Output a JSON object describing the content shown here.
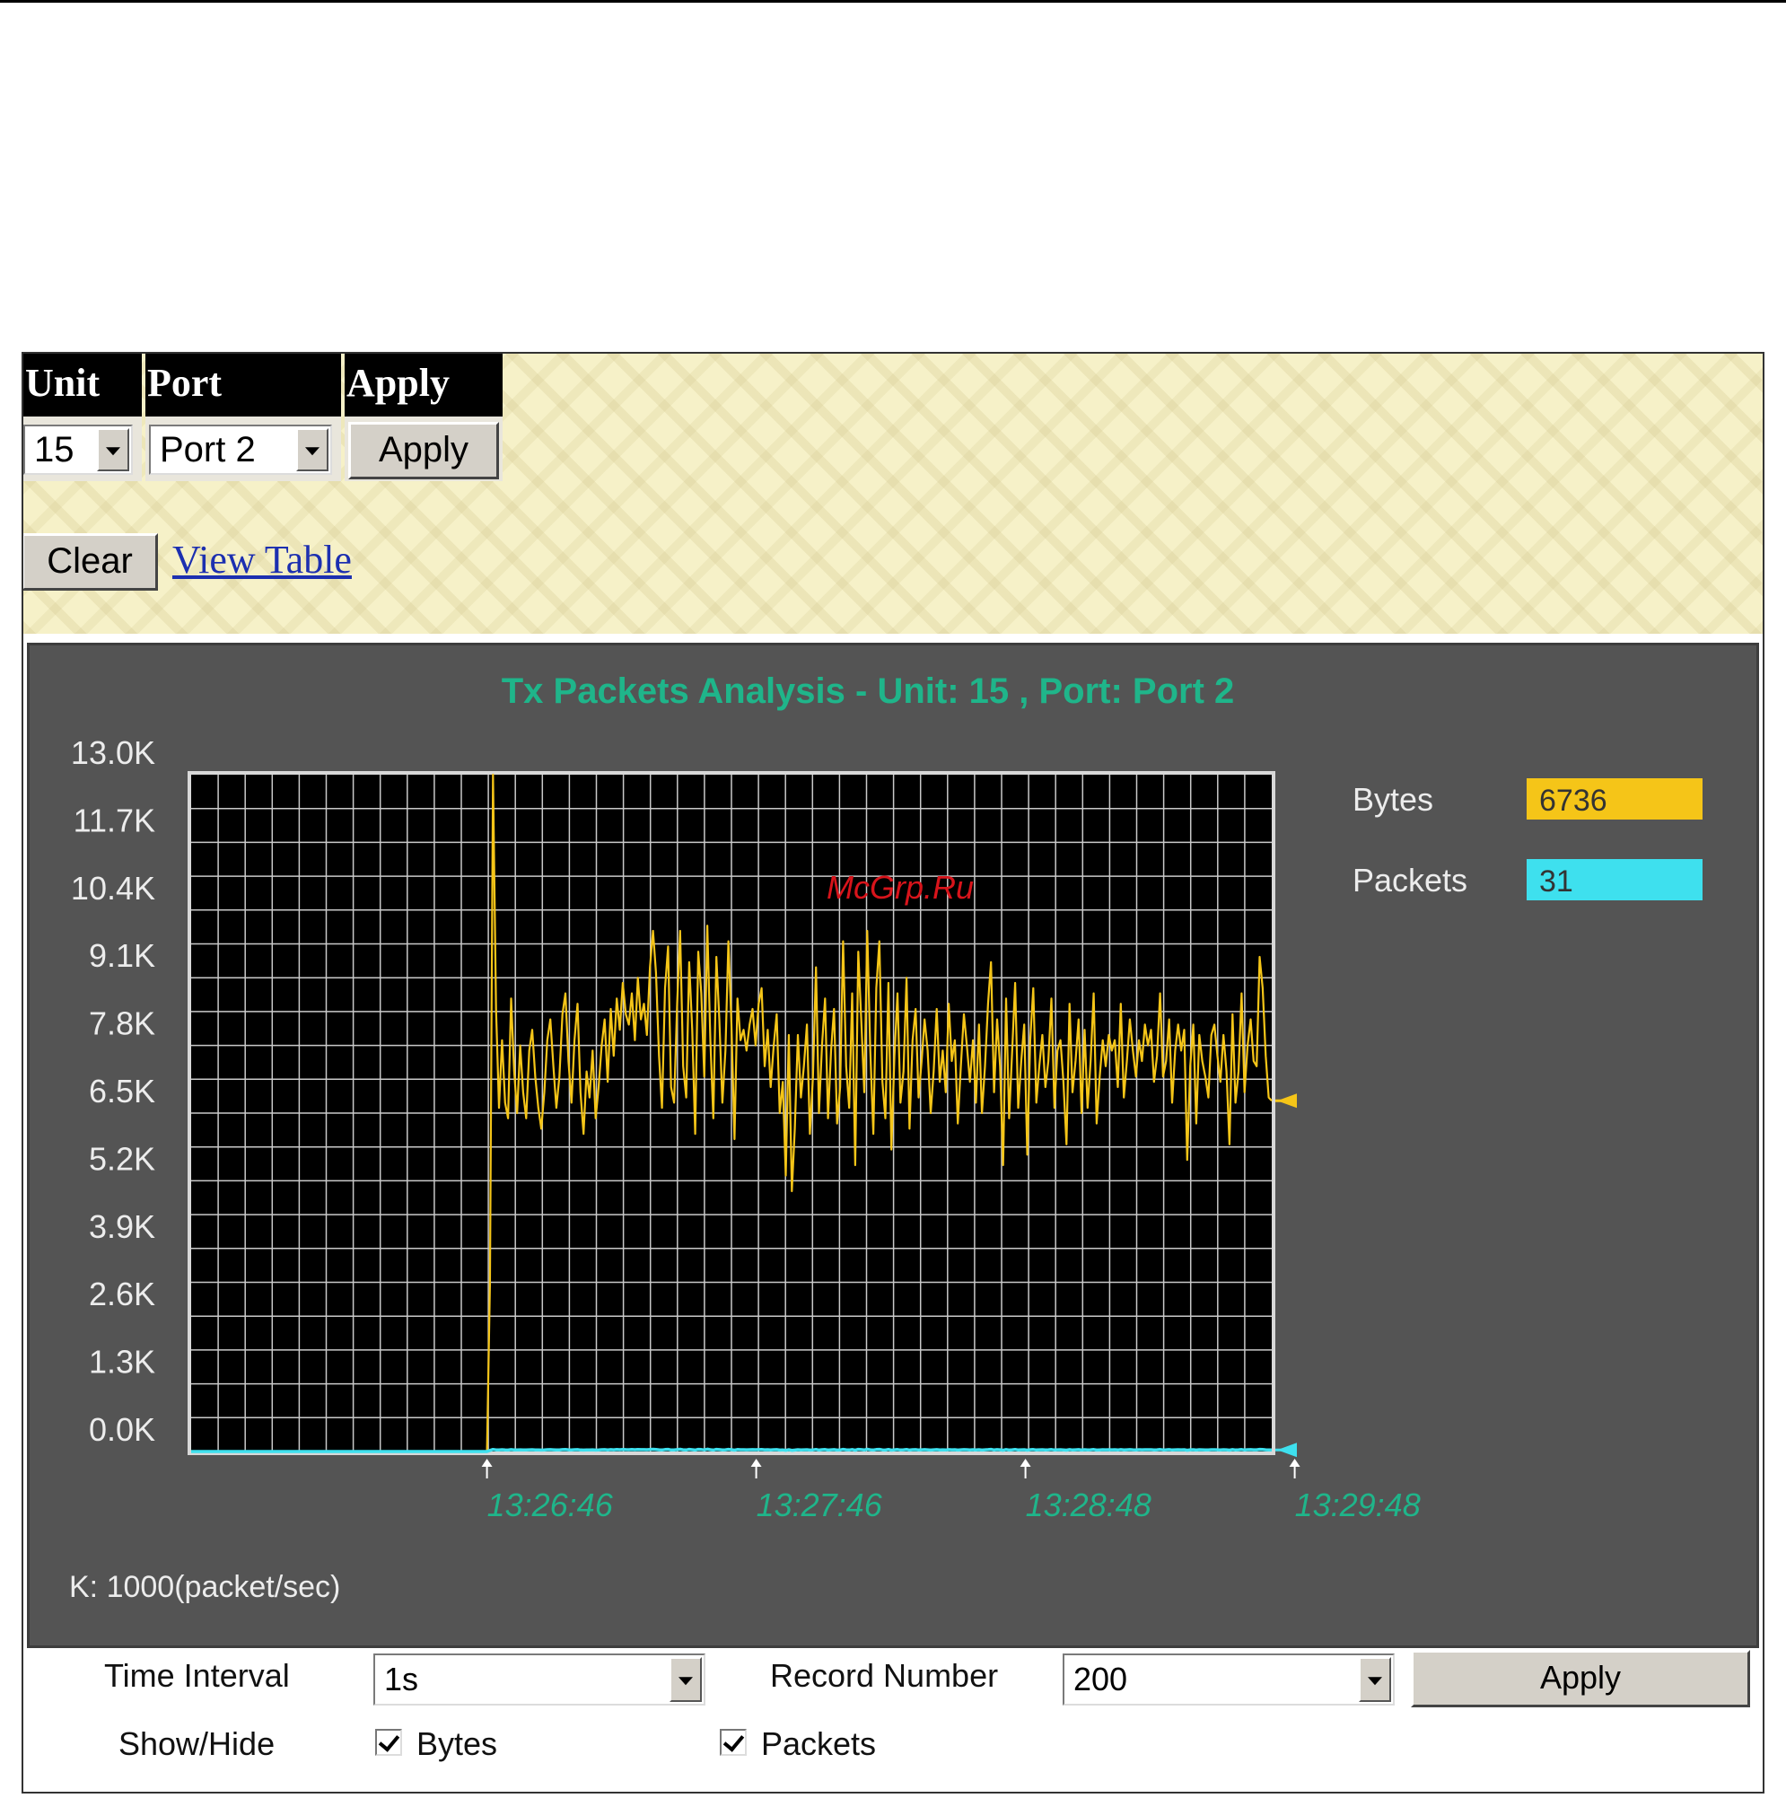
{
  "controls": {
    "unit_header": "Unit",
    "port_header": "Port",
    "apply_header": "Apply",
    "unit_value": "15",
    "port_value": "Port 2",
    "apply_label": "Apply",
    "clear_label": "Clear",
    "view_table_label": "View Table"
  },
  "watermark": "McGrp.Ru",
  "legend": [
    {
      "label": "Bytes",
      "value": "6736",
      "color": "#f5c518"
    },
    {
      "label": "Packets",
      "value": "31",
      "color": "#3ee0ee"
    }
  ],
  "chart_data": {
    "type": "line",
    "title": "Tx Packets Analysis - Unit: 15 , Port: Port 2",
    "y_ticks": [
      "13.0K",
      "11.7K",
      "10.4K",
      "9.1K",
      "7.8K",
      "6.5K",
      "5.2K",
      "3.9K",
      "2.6K",
      "1.3K",
      "0.0K"
    ],
    "ylim": [
      0,
      13000
    ],
    "x_ticks": [
      "13:26:46",
      "13:27:46",
      "13:28:48",
      "13:29:48"
    ],
    "unit_note": "K: 1000(packet/sec)",
    "grid": true,
    "series": [
      {
        "name": "Bytes",
        "color": "#f5c518",
        "values": [
          0,
          0,
          0,
          0,
          0,
          0,
          0,
          0,
          0,
          0,
          0,
          0,
          0,
          0,
          0,
          0,
          0,
          0,
          0,
          0,
          0,
          0,
          0,
          0,
          0,
          0,
          0,
          0,
          0,
          0,
          0,
          0,
          0,
          0,
          0,
          0,
          0,
          0,
          0,
          0,
          0,
          0,
          0,
          0,
          0,
          0,
          0,
          0,
          0,
          0,
          0,
          0,
          0,
          0,
          0,
          0,
          0,
          0,
          0,
          0,
          0,
          0,
          0,
          0,
          0,
          0,
          0,
          0,
          0,
          0,
          0,
          0,
          0,
          0,
          0,
          0,
          0,
          0,
          0,
          0,
          0,
          0,
          0,
          0,
          0,
          0,
          0,
          0,
          0,
          0,
          0,
          0,
          0,
          0,
          0,
          0,
          0,
          0,
          0,
          3200,
          13000,
          8500,
          6600,
          7900,
          6700,
          6400,
          8700,
          7300,
          6500,
          7800,
          6900,
          6400,
          7700,
          8100,
          7200,
          6600,
          6200,
          6900,
          7900,
          8300,
          7400,
          6600,
          7200,
          8400,
          8800,
          7500,
          6700,
          7900,
          8600,
          6900,
          6100,
          7300,
          6800,
          7700,
          6400,
          7000,
          7800,
          8300,
          7100,
          8500,
          7600,
          8700,
          8100,
          9000,
          8400,
          8200,
          8800,
          7900,
          9100,
          8300,
          8600,
          8000,
          9300,
          10000,
          9200,
          7600,
          6600,
          8900,
          9700,
          7000,
          6700,
          8600,
          10000,
          7400,
          6800,
          9400,
          8100,
          6100,
          9600,
          8800,
          7200,
          10100,
          7900,
          6400,
          9500,
          8300,
          6700,
          7700,
          9800,
          8200,
          6000,
          8700,
          7900,
          8100,
          7700,
          8200,
          8500,
          7800,
          8600,
          8900,
          7400,
          8100,
          7000,
          7800,
          8400,
          6500,
          7100,
          5300,
          8000,
          5000,
          6200,
          8000,
          6800,
          7400,
          8200,
          6100,
          7200,
          9300,
          6500,
          7800,
          8700,
          6400,
          7700,
          8500,
          6300,
          7000,
          9800,
          7400,
          6600,
          8800,
          5500,
          9600,
          8300,
          6900,
          10000,
          7700,
          6100,
          8900,
          9800,
          7100,
          6400,
          9000,
          5800,
          7600,
          8800,
          6700,
          7300,
          9100,
          6200,
          7900,
          8500,
          6800,
          7500,
          8300,
          7700,
          6500,
          7300,
          8500,
          7100,
          7700,
          6900,
          8600,
          7500,
          7900,
          6300,
          7400,
          8400,
          7800,
          7100,
          7900,
          6700,
          8200,
          6500,
          7400,
          8600,
          9400,
          6900,
          8300,
          7400,
          5500,
          8700,
          6400,
          7700,
          9000,
          6600,
          7500,
          8200,
          5700,
          7900,
          8900,
          6700,
          7400,
          8000,
          7000,
          7500,
          8700,
          6600,
          7700,
          7900,
          7100,
          5900,
          8600,
          6900,
          7500,
          8300,
          6500,
          8100,
          6600,
          7500,
          8800,
          6300,
          7200,
          7900,
          7400,
          8000,
          7700,
          7900,
          7000,
          8600,
          6800,
          7500,
          8300,
          7700,
          7200,
          7900,
          7500,
          8200,
          7800,
          8100,
          7100,
          7600,
          8800,
          7200,
          7500,
          8300,
          6700,
          7700,
          8200,
          7700,
          8100,
          5600,
          7400,
          8200,
          6300,
          8000,
          7500,
          7200,
          6800,
          8000,
          8200,
          7600,
          7100,
          8000,
          7300,
          5900,
          8400,
          6700,
          7300,
          8800,
          6900,
          7800,
          8300,
          7500,
          7400,
          9500,
          8900,
          7600,
          6800,
          6736
        ]
      },
      {
        "name": "Packets",
        "color": "#3ee0ee",
        "values": [
          0,
          0,
          0,
          0,
          0,
          0,
          0,
          0,
          0,
          0,
          0,
          0,
          0,
          0,
          0,
          0,
          0,
          0,
          0,
          0,
          0,
          0,
          0,
          0,
          0,
          0,
          0,
          0,
          0,
          0,
          0,
          0,
          0,
          0,
          0,
          0,
          0,
          0,
          0,
          0,
          0,
          0,
          0,
          0,
          0,
          0,
          0,
          0,
          0,
          0,
          0,
          0,
          0,
          0,
          0,
          0,
          0,
          0,
          0,
          0,
          0,
          0,
          0,
          0,
          0,
          0,
          0,
          0,
          0,
          0,
          0,
          0,
          0,
          0,
          0,
          0,
          0,
          0,
          0,
          0,
          0,
          0,
          0,
          0,
          0,
          0,
          0,
          0,
          0,
          0,
          0,
          0,
          0,
          0,
          0,
          0,
          0,
          0,
          0,
          20,
          40,
          31,
          29,
          34,
          30,
          28,
          36,
          31,
          29,
          33,
          30,
          29,
          33,
          35,
          31,
          29,
          28,
          30,
          34,
          36,
          32,
          29,
          31,
          36,
          38,
          32,
          29,
          34,
          37,
          30,
          27,
          31,
          29,
          33,
          28,
          30,
          34,
          36,
          31,
          37,
          33,
          38,
          35,
          39,
          36,
          35,
          38,
          34,
          39,
          36,
          37,
          34,
          40,
          43,
          40,
          33,
          29,
          38,
          42,
          30,
          29,
          37,
          43,
          32,
          29,
          41,
          35,
          27,
          42,
          38,
          31,
          44,
          34,
          28,
          41,
          36,
          29,
          33,
          42,
          35,
          26,
          38,
          34,
          35,
          33,
          35,
          37,
          34,
          37,
          38,
          32,
          35,
          30,
          34,
          36,
          28,
          31,
          23,
          35,
          22,
          27,
          35,
          29,
          32,
          35,
          27,
          31,
          40,
          28,
          34,
          38,
          28,
          33,
          37,
          27,
          30,
          42,
          32,
          29,
          38,
          24,
          41,
          36,
          30,
          43,
          33,
          27,
          38,
          42,
          31,
          28,
          39,
          25,
          33,
          38,
          29,
          32,
          39,
          27,
          34,
          37,
          29,
          32,
          36,
          33,
          28,
          32,
          37,
          31,
          33,
          30,
          37,
          32,
          34,
          27,
          32,
          36,
          34,
          31,
          34,
          29,
          35,
          28,
          32,
          37,
          41,
          30,
          36,
          32,
          24,
          38,
          28,
          33,
          39,
          29,
          32,
          35,
          25,
          34,
          38,
          29,
          32,
          35,
          30,
          32,
          38,
          29,
          33,
          34,
          31,
          26,
          37,
          30,
          32,
          36,
          28,
          35,
          29,
          32,
          38,
          27,
          31,
          34,
          32,
          35,
          33,
          34,
          30,
          37,
          29,
          32,
          36,
          33,
          31,
          34,
          32,
          35,
          34,
          35,
          31,
          33,
          38,
          31,
          32,
          36,
          29,
          33,
          35,
          33,
          35,
          24,
          32,
          35,
          27,
          35,
          32,
          31,
          29,
          35,
          35,
          33,
          31,
          35,
          32,
          26,
          36,
          29,
          32,
          38,
          30,
          34,
          36,
          32,
          32,
          41,
          38,
          33,
          29,
          31
        ]
      }
    ]
  },
  "form": {
    "time_interval_label": "Time Interval",
    "time_interval_value": "1s",
    "record_number_label": "Record Number",
    "record_number_value": "200",
    "apply_label": "Apply",
    "show_hide_label": "Show/Hide",
    "bytes_label": "Bytes",
    "packets_label": "Packets"
  }
}
